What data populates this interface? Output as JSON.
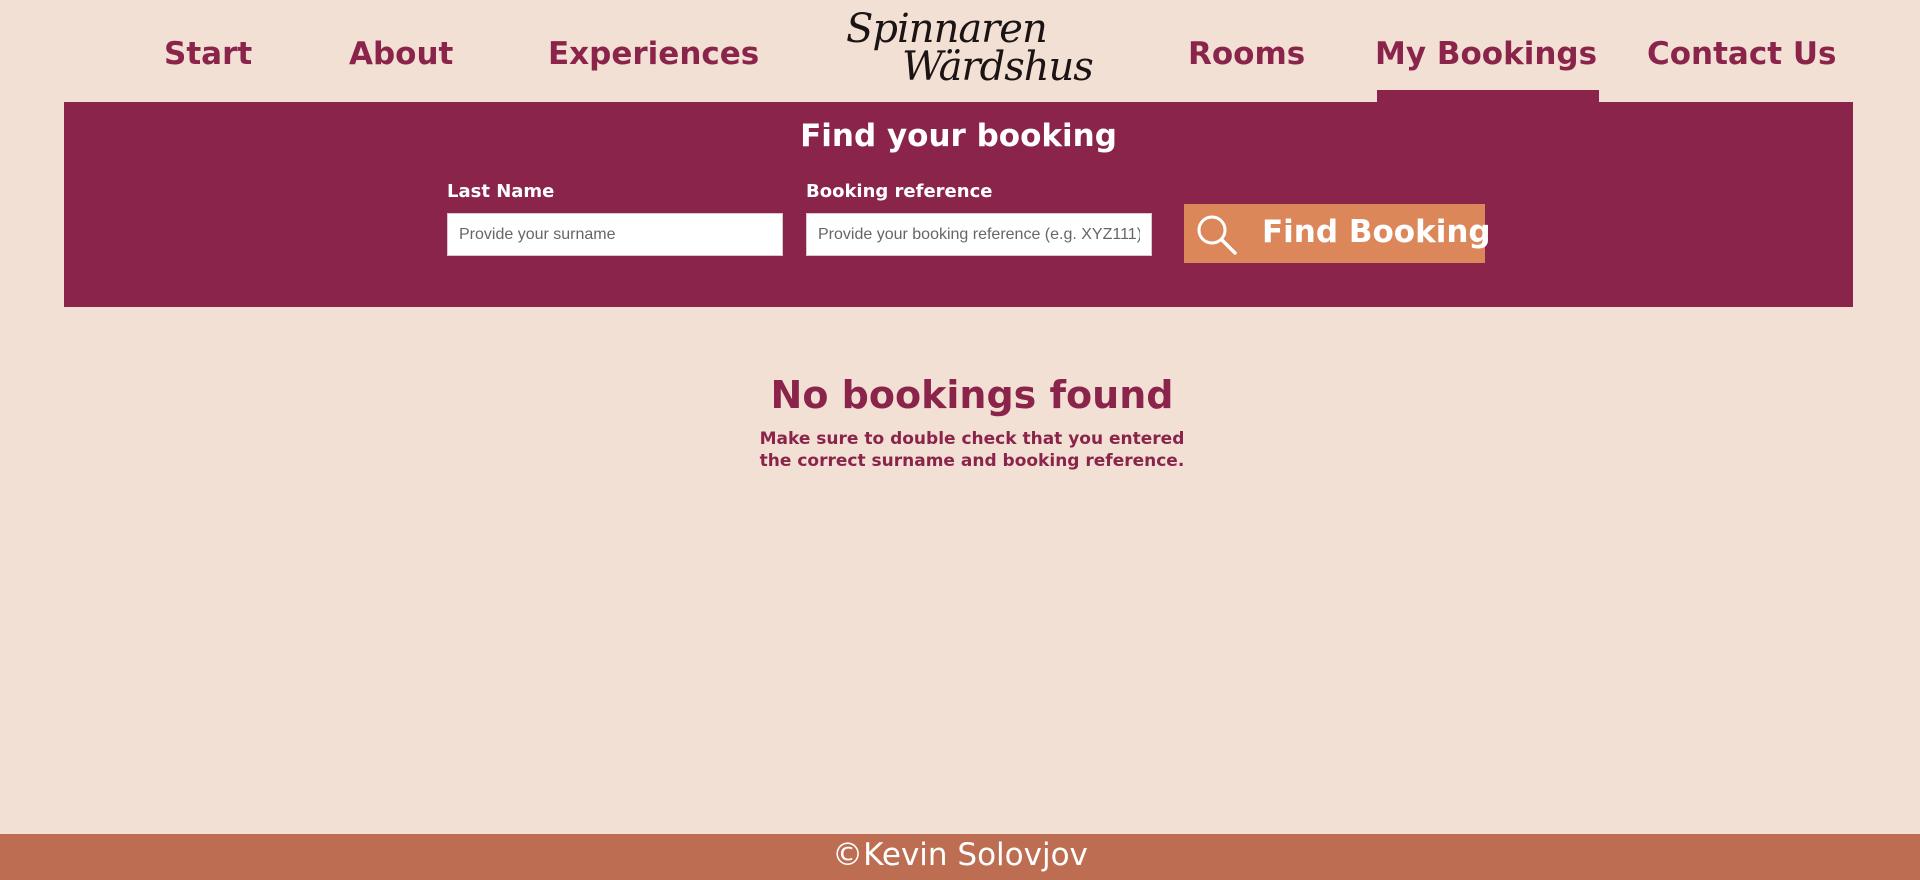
{
  "nav": {
    "items": [
      {
        "label": "Start"
      },
      {
        "label": "About"
      },
      {
        "label": "Experiences"
      },
      {
        "label": "Rooms"
      },
      {
        "label": "My Bookings",
        "active": true
      },
      {
        "label": "Contact Us"
      }
    ],
    "logo": {
      "line1": "Spinnaren",
      "line2": "Wärdshus"
    }
  },
  "search": {
    "title": "Find your booking",
    "last_name": {
      "label": "Last Name",
      "placeholder": "Provide your surname",
      "value": ""
    },
    "reference": {
      "label": "Booking reference",
      "placeholder": "Provide your booking reference (e.g. XYZ111)",
      "value": ""
    },
    "button_label": "Find Booking",
    "button_icon": "search-icon"
  },
  "result": {
    "title": "No bookings found",
    "message_line1": "Make sure to double check that you entered",
    "message_line2": "the correct surname and booking reference."
  },
  "footer": {
    "text": "©Kevin Solovjov"
  },
  "colors": {
    "background": "#f2e0d5",
    "primary": "#8b244a",
    "accent": "#dc875a",
    "footer": "#bd6e52"
  }
}
